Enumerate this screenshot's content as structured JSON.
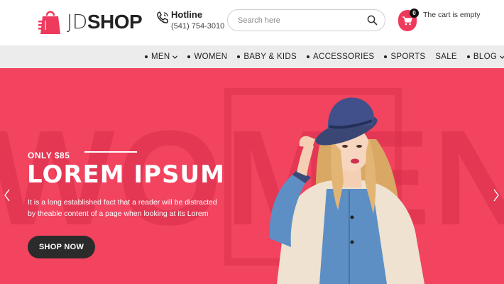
{
  "header": {
    "logo": {
      "part1": "JD",
      "part2": "SHOP"
    },
    "hotline": {
      "title": "Hotline",
      "phone": "(541) 754-3010"
    },
    "search": {
      "placeholder": "Search here"
    },
    "cart": {
      "count": "0",
      "status": "The cart is empty"
    }
  },
  "nav": {
    "items": [
      {
        "label": "MEN",
        "dot": true,
        "dropdown": true
      },
      {
        "label": "WOMEN",
        "dot": true,
        "dropdown": false
      },
      {
        "label": "BABY & KIDS",
        "dot": true,
        "dropdown": false
      },
      {
        "label": "ACCESSORIES",
        "dot": true,
        "dropdown": false
      },
      {
        "label": "SPORTS",
        "dot": true,
        "dropdown": false
      },
      {
        "label": "SALE",
        "dot": false,
        "dropdown": false
      },
      {
        "label": "BLOG",
        "dot": true,
        "dropdown": true
      }
    ]
  },
  "hero": {
    "background_word": "WOMEN",
    "price": "ONLY $85",
    "title": "LOREM IPSUM",
    "description": "It is a long established fact that a reader will be distracted by theable content of a page when looking at its Lorem",
    "button": "SHOP NOW"
  },
  "colors": {
    "brand": "#ee3a5c",
    "hero_bg": "#f2435f",
    "nav_bg": "#ececec",
    "button_dark": "#2b2b2b"
  },
  "icons": {
    "logo": "shopping-bag-icon",
    "hotline": "phone-icon",
    "search": "magnifier-icon",
    "cart": "cart-icon",
    "prev": "chevron-left-icon",
    "next": "chevron-right-icon"
  }
}
